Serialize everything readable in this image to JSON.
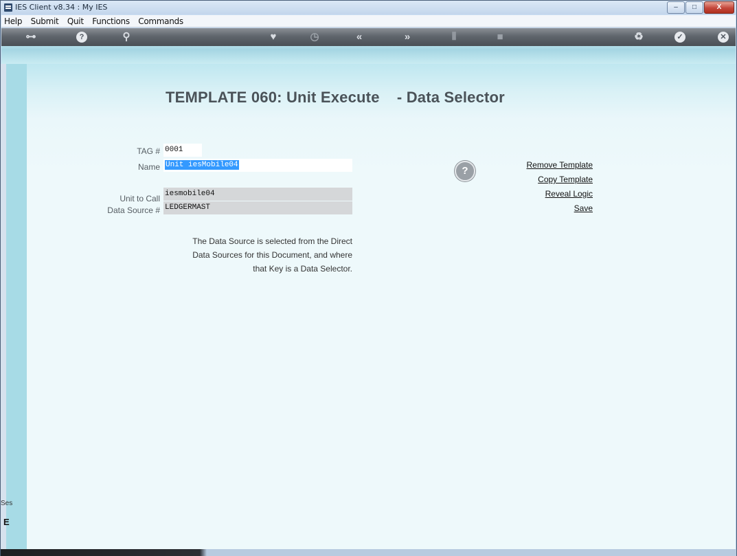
{
  "window": {
    "title": "IES Client v8.34 : My IES",
    "minimize_glyph": "–",
    "maximize_glyph": "□",
    "close_glyph": "X"
  },
  "menu": {
    "items": [
      "Help",
      "Submit",
      "Quit",
      "Functions",
      "Commands"
    ]
  },
  "toolbar": {
    "icons": [
      {
        "name": "key-icon",
        "glyph": "⊶"
      },
      {
        "name": "help-icon",
        "glyph": "?"
      },
      {
        "name": "search-icon",
        "glyph": "⚲"
      },
      {
        "name": "heart-icon",
        "glyph": "♥"
      },
      {
        "name": "clock-icon",
        "glyph": "◷"
      },
      {
        "name": "rewind-icon",
        "glyph": "«"
      },
      {
        "name": "forward-icon",
        "glyph": "»"
      },
      {
        "name": "tools-icon",
        "glyph": "⫴"
      },
      {
        "name": "square-icon",
        "glyph": "■"
      },
      {
        "name": "recycle-icon",
        "glyph": "♻"
      },
      {
        "name": "check-icon",
        "glyph": "✓"
      },
      {
        "name": "close-icon",
        "glyph": "✕"
      }
    ]
  },
  "page": {
    "title": "TEMPLATE 060: Unit Execute    - Data Selector"
  },
  "form": {
    "tag_label": "TAG #",
    "tag_value": "0001",
    "name_label": "Name",
    "name_value": "Unit iesMobile04",
    "unit_label": "Unit to Call",
    "unit_value": "iesmobile04",
    "source_label": "Data Source #",
    "source_value": "LEDGERMAST"
  },
  "note": {
    "line1": "The Data Source is selected from the Direct",
    "line2": "Data Sources for this Document, and where",
    "line3": "that Key is a Data Selector."
  },
  "help_circle": "?",
  "actions": {
    "remove": "Remove Template",
    "copy": "Copy Template",
    "reveal": "Reveal Logic",
    "save": "Save"
  },
  "side": {
    "session_label": "Ses",
    "glyph": "E"
  },
  "colors": {
    "accent": "#3399ff",
    "content_bg": "#eef9fb",
    "left_strip": "#a7dbe6"
  }
}
